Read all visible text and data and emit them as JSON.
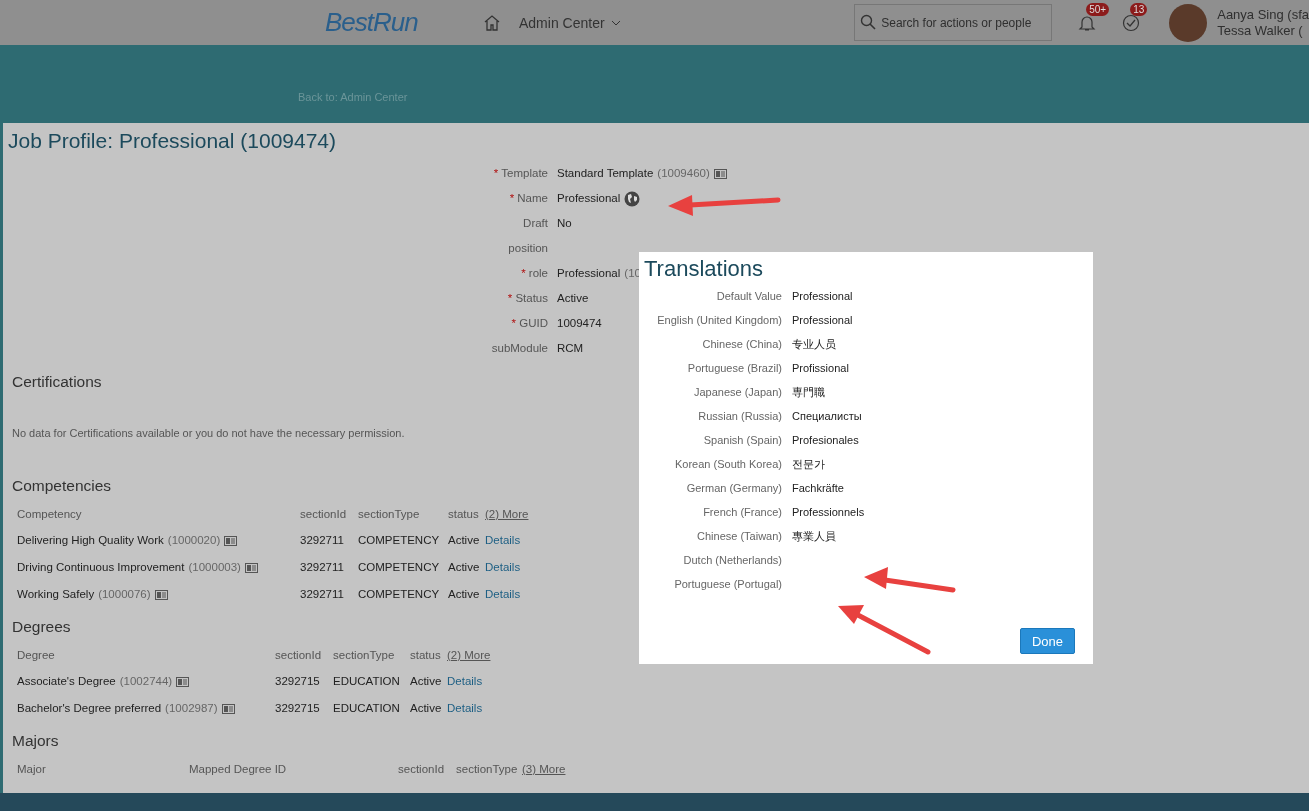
{
  "header": {
    "logo": "BestRun",
    "nav_menu": "Admin Center",
    "search": {
      "placeholder": "Search for actions or people"
    },
    "notifications_badge": "50+",
    "tasks_badge": "13",
    "user_name": "Aanya Sing (sfa",
    "proxy_name": "Tessa Walker ("
  },
  "breadcrumb": "Back to: Admin Center",
  "profile": {
    "title": "Job Profile: Professional (1009474)",
    "fields": [
      {
        "label": "Template",
        "required_mark": "*",
        "value": "Standard Template",
        "id": "(1009460)",
        "kind": "lookup"
      },
      {
        "label": "Name",
        "required_mark": "*",
        "value": "Professional",
        "kind": "translatable"
      },
      {
        "label": "Draft",
        "value": "No",
        "kind": "text"
      },
      {
        "label": "position",
        "kind": "text"
      },
      {
        "label": "role",
        "required_mark": "*",
        "value": "Professional",
        "id": "(10",
        "kind": "text"
      },
      {
        "label": "Status",
        "required_mark": "*",
        "value": "Active",
        "kind": "text"
      },
      {
        "label": "GUID",
        "required_mark": "*",
        "value": "1009474",
        "kind": "text"
      },
      {
        "label": "subModule",
        "value": "RCM",
        "kind": "text"
      }
    ]
  },
  "sections": [
    {
      "title": "Certifications",
      "empty_message": "No data for Certifications available or you do not have the necessary permission."
    },
    {
      "title": "Competencies",
      "table": {
        "columns": [
          "Competency",
          "sectionId",
          "sectionType",
          "status"
        ],
        "more": "(2) More",
        "rows": [
          {
            "cells": [
              {
                "text": "Delivering High Quality Work",
                "id": "(1000020)"
              },
              {
                "text": "3292711"
              },
              {
                "text": "COMPETENCY"
              },
              {
                "text": "Active"
              }
            ],
            "link": "Details"
          },
          {
            "cells": [
              {
                "text": "Driving Continuous Improvement",
                "id": "(1000003)"
              },
              {
                "text": "3292711"
              },
              {
                "text": "COMPETENCY"
              },
              {
                "text": "Active"
              }
            ],
            "link": "Details"
          },
          {
            "cells": [
              {
                "text": "Working Safely",
                "id": "(1000076)"
              },
              {
                "text": "3292711"
              },
              {
                "text": "COMPETENCY"
              },
              {
                "text": "Active"
              }
            ],
            "link": "Details"
          }
        ]
      }
    },
    {
      "title": "Degrees",
      "table": {
        "columns": [
          "Degree",
          "sectionId",
          "sectionType",
          "status"
        ],
        "more": "(2) More",
        "rows": [
          {
            "cells": [
              {
                "text": "Associate's Degree",
                "id": "(1002744)"
              },
              {
                "text": "3292715"
              },
              {
                "text": "EDUCATION"
              },
              {
                "text": "Active"
              }
            ],
            "link": "Details"
          },
          {
            "cells": [
              {
                "text": "Bachelor's Degree preferred",
                "id": "(1002987)"
              },
              {
                "text": "3292715"
              },
              {
                "text": "EDUCATION"
              },
              {
                "text": "Active"
              }
            ],
            "link": "Details"
          }
        ]
      }
    },
    {
      "title": "Majors",
      "table": {
        "columns": [
          "Major",
          "Mapped Degree ID",
          "sectionId",
          "sectionType"
        ],
        "more": "(3) More"
      }
    }
  ],
  "dialog": {
    "title": "Translations",
    "rows": [
      {
        "language": "Default Value",
        "value": "Professional"
      },
      {
        "language": "English (United Kingdom)",
        "value": "Professional"
      },
      {
        "language": "Chinese (China)",
        "value": "专业人员"
      },
      {
        "language": "Portuguese (Brazil)",
        "value": "Profissional"
      },
      {
        "language": "Japanese (Japan)",
        "value": "専門職"
      },
      {
        "language": "Russian (Russia)",
        "value": "Специалисты"
      },
      {
        "language": "Spanish (Spain)",
        "value": "Profesionales"
      },
      {
        "language": "Korean (South Korea)",
        "value": "전문가"
      },
      {
        "language": "German (Germany)",
        "value": "Fachkräfte"
      },
      {
        "language": "French (France)",
        "value": "Professionnels"
      },
      {
        "language": "Chinese (Taiwan)",
        "value": "專業人員"
      },
      {
        "language": "Dutch (Netherlands)"
      },
      {
        "language": "Portuguese (Portugal)"
      }
    ],
    "button": "Done"
  }
}
